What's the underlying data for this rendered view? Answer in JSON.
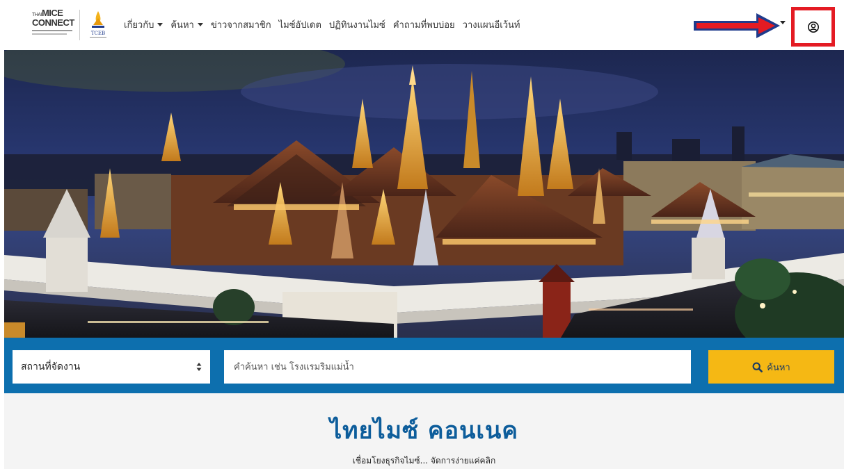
{
  "logos": {
    "primary_line1": "THAI",
    "primary_line2": "MICE",
    "primary_line3": "CONNECT",
    "partner": "TCEB"
  },
  "nav": {
    "items": [
      {
        "label": "เกี่ยวกับ",
        "dropdown": true
      },
      {
        "label": "ค้นหา",
        "dropdown": true
      },
      {
        "label": "ข่าวจากสมาชิก",
        "dropdown": false
      },
      {
        "label": "ไมซ์อัปเดต",
        "dropdown": false
      },
      {
        "label": "ปฏิทินงานไมซ์",
        "dropdown": false
      },
      {
        "label": "คำถามที่พบบ่อย",
        "dropdown": false
      },
      {
        "label": "วางแผนอีเว้นท์",
        "dropdown": false
      }
    ],
    "user_icon": "user-circle-icon"
  },
  "annotation": {
    "arrow_color": "#e41b23",
    "arrow_outline": "#1f3b8c",
    "highlight_color": "#e41b23"
  },
  "hero": {
    "scene": "grand-palace-night"
  },
  "search": {
    "select_value": "สถานที่จัดงาน",
    "keyword_placeholder": "คำค้นหา เช่น โรงแรมริมแม่น้ำ",
    "button_label": "ค้นหา",
    "button_icon": "search-icon"
  },
  "intro": {
    "title": "ไทยไมซ์ คอนเนค",
    "subtitle": "เชื่อมโยงธุรกิจไมซ์... จัดการง่ายแค่คลิก"
  },
  "colors": {
    "search_bar": "#0d6fae",
    "search_button": "#f5b814",
    "title": "#0d5d9b"
  }
}
